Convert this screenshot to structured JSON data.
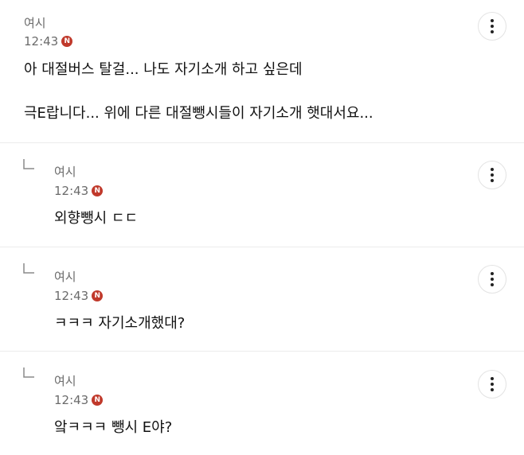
{
  "comments": [
    {
      "author": "여시",
      "time": "12:43",
      "badge": "N",
      "lines": [
        "아 대절버스 탈걸... 나도 자기소개 하고 싶은데",
        "극E랍니다... 위에 다른 대절뺑시들이 자기소개 햇대서요..."
      ]
    }
  ],
  "replies": [
    {
      "author": "여시",
      "time": "12:43",
      "badge": "N",
      "text": "외향뺑시 ㄷㄷ"
    },
    {
      "author": "여시",
      "time": "12:43",
      "badge": "N",
      "text": "ㅋㅋㅋ 자기소개했대?"
    },
    {
      "author": "여시",
      "time": "12:43",
      "badge": "N",
      "text": "앜ㅋㅋㅋ 뺑시 E야?"
    }
  ],
  "icons": {
    "more": "more-vertical-icon",
    "reply": "reply-arrow-icon"
  },
  "colors": {
    "badge": "#c0392b",
    "divider": "#ececec",
    "meta_text": "#6b6b6b"
  }
}
